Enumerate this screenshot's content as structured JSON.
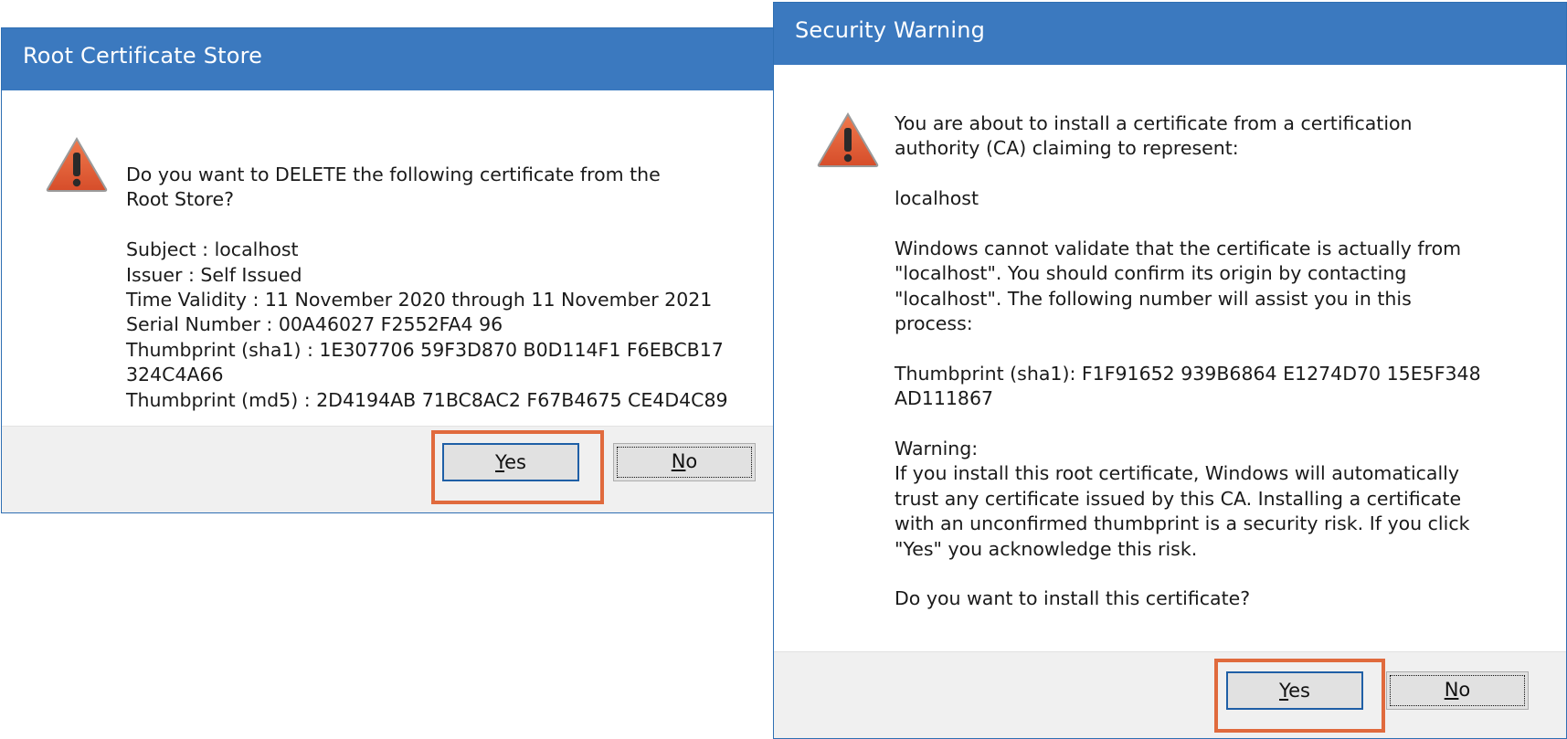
{
  "root_dialog": {
    "title": "Root Certificate Store",
    "close_glyph": "✕",
    "icon": "warning-triangle-icon",
    "message_lines": [
      "Do you want to DELETE the following certificate from the",
      "Root Store?"
    ],
    "detail_lines": [
      "Subject : localhost",
      "Issuer : Self Issued",
      "Time Validity : 11 November 2020 through 11 November 2021",
      "Serial Number : 00A46027 F2552FA4 96",
      "Thumbprint (sha1) : 1E307706 59F3D870 B0D114F1 F6EBCB17",
      "324C4A66",
      "Thumbprint (md5) : 2D4194AB 71BC8AC2 F67B4675 CE4D4C89"
    ],
    "yes_label": "Yes",
    "no_label": "No"
  },
  "security_dialog": {
    "title": "Security Warning",
    "close_glyph": "✕",
    "icon": "warning-triangle-icon",
    "intro_lines": [
      "You are about to install a certificate from a certification",
      "authority (CA) claiming to represent:"
    ],
    "subject": "localhost",
    "validate_lines": [
      "Windows cannot validate that the certificate is actually from",
      "\"localhost\". You should confirm its origin by contacting",
      "\"localhost\". The following number will assist you in this",
      "process:"
    ],
    "thumbprint_lines": [
      "Thumbprint (sha1): F1F91652 939B6864 E1274D70 15E5F348",
      "AD111867"
    ],
    "warning_lines": [
      "Warning:",
      "If you install this root certificate, Windows will automatically",
      "trust any certificate issued by this CA. Installing a certificate",
      "with an unconfirmed thumbprint is a security risk. If you click",
      "\"Yes\" you acknowledge this risk."
    ],
    "question": "Do you want to install this certificate?",
    "yes_label": "Yes",
    "no_label": "No"
  },
  "colors": {
    "titlebar": "#3b79bf",
    "highlight": "#e06a3d",
    "warning_icon": "#e0603a"
  }
}
